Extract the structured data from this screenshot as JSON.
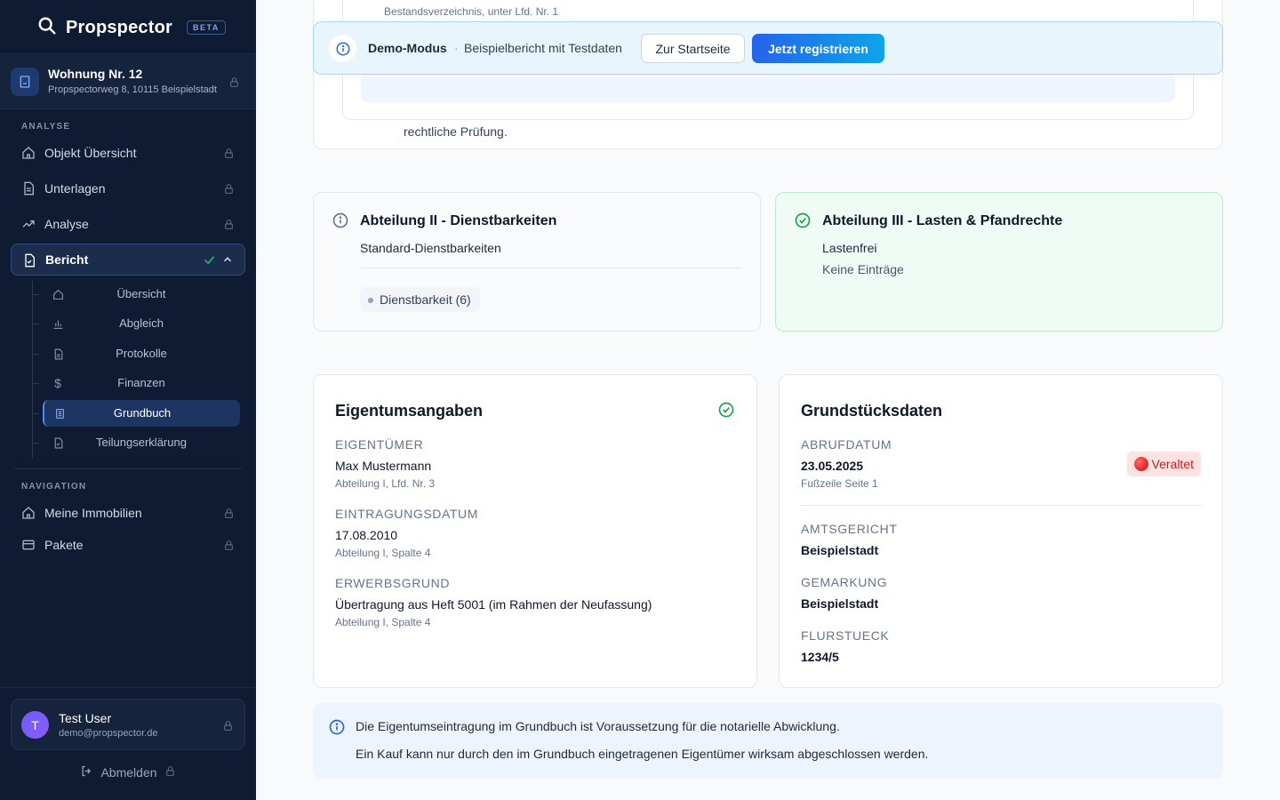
{
  "app": {
    "name": "Propspector",
    "beta_label": "BETA"
  },
  "property": {
    "title": "Wohnung Nr. 12",
    "address": "Propspectorweg 8, 10115 Beispielstadt"
  },
  "sidebar": {
    "analysis_label": "ANALYSE",
    "items": [
      {
        "label": "Objekt Übersicht",
        "icon": "home-icon"
      },
      {
        "label": "Unterlagen",
        "icon": "document-icon"
      },
      {
        "label": "Analyse",
        "icon": "trend-icon"
      },
      {
        "label": "Bericht",
        "icon": "report-icon"
      }
    ],
    "sub_items": [
      {
        "label": "Übersicht",
        "icon": "home-icon"
      },
      {
        "label": "Abgleich",
        "icon": "bar-chart-icon"
      },
      {
        "label": "Protokolle",
        "icon": "document-icon"
      },
      {
        "label": "Finanzen",
        "icon": "dollar-icon"
      },
      {
        "label": "Grundbuch",
        "icon": "building-icon"
      },
      {
        "label": "Teilungserklärung",
        "icon": "file-check-icon"
      }
    ],
    "navigation_label": "NAVIGATION",
    "nav_items": [
      {
        "label": "Meine Immobilien",
        "icon": "home-icon"
      },
      {
        "label": "Pakete",
        "icon": "card-icon"
      }
    ]
  },
  "user": {
    "initial": "T",
    "name": "Test User",
    "email": "demo@propspector.de",
    "logout_label": "Abmelden"
  },
  "top_section": {
    "bestand_text": "Bestandsverzeichnis, unter Lfd. Nr. 1",
    "pruefung_text": "rechtliche Prüfung."
  },
  "demo": {
    "title": "Demo-Modus",
    "separator": "·",
    "text": "Beispielbericht mit Testdaten",
    "home_button": "Zur Startseite",
    "register_button": "Jetzt registrieren"
  },
  "abteilung2": {
    "title": "Abteilung II - Dienstbarkeiten",
    "subtitle": "Standard-Dienstbarkeiten",
    "chip": "Dienstbarkeit (6)"
  },
  "abteilung3": {
    "title": "Abteilung III - Lasten & Pfandrechte",
    "status": "Lastenfrei",
    "note": "Keine Einträge"
  },
  "eigentum": {
    "title": "Eigentumsangaben",
    "fields": [
      {
        "label": "Eigentümer",
        "value": "Max Mustermann",
        "note": "Abteilung I, Lfd. Nr. 3"
      },
      {
        "label": "Eintragungsdatum",
        "value": "17.08.2010",
        "note": "Abteilung I, Spalte 4"
      },
      {
        "label": "Erwerbsgrund",
        "value": "Übertragung aus Heft 5001 (im Rahmen der Neufassung)",
        "note": "Abteilung I, Spalte 4"
      }
    ]
  },
  "grundstueck": {
    "title": "Grundstücksdaten",
    "abruf_label": "Abrufdatum",
    "abruf_value": "23.05.2025",
    "abruf_note": "Fußzeile Seite 1",
    "badge": "Veraltet",
    "fields": [
      {
        "label": "Amtsgericht",
        "value": "Beispielstadt"
      },
      {
        "label": "Gemarkung",
        "value": "Beispielstadt"
      },
      {
        "label": "Flurstueck",
        "value": "1234/5"
      }
    ]
  },
  "info": {
    "line1": "Die Eigentumseintragung im Grundbuch ist Voraussetzung für die notarielle Abwicklung.",
    "line2": "Ein Kauf kann nur durch den im Grundbuch eingetragenen Eigentümer wirksam abgeschlossen werden."
  },
  "colors": {
    "sidebar_bg": "#0f1b33",
    "accent": "#2563eb",
    "success": "#16a34a",
    "danger": "#c81e1e"
  }
}
